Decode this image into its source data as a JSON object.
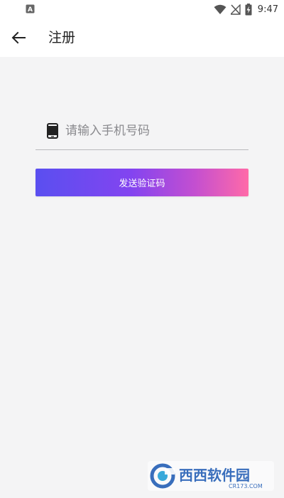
{
  "status_bar": {
    "time": "9:47",
    "left_icon": "notification-a-icon",
    "icons": [
      "wifi-icon",
      "signal-off-icon",
      "battery-charging-icon"
    ]
  },
  "app_bar": {
    "back_icon": "arrow-left-icon",
    "title": "注册"
  },
  "form": {
    "phone_icon": "smartphone-icon",
    "phone_value": "",
    "phone_placeholder": "请输入手机号码",
    "send_code_label": "发送验证码"
  },
  "colors": {
    "background": "#f4f4f5",
    "button_gradient_start": "#5a4ff0",
    "button_gradient_end": "#ff6aa8"
  },
  "watermark": {
    "text": "西西软件园",
    "sub": "CR173.COM"
  }
}
